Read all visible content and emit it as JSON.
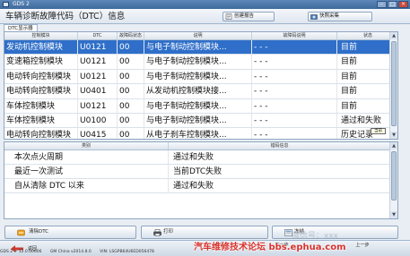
{
  "window": {
    "title": "GDS 2"
  },
  "header": {
    "title": "车辆诊断故障代码（DTC）信息",
    "report_button": "创建报告",
    "save_button": "快照采集"
  },
  "tab": {
    "label": "DTC显示器"
  },
  "dtc_table": {
    "columns": [
      "控制模块",
      "DTC",
      "故障码状态",
      "说明",
      "故障码说明",
      "状态"
    ],
    "rows": [
      [
        "发动机控制模块",
        "U0121",
        "00",
        "与电子制动控制模块...",
        "- - -",
        "目前"
      ],
      [
        "变速箱控制模块",
        "U0121",
        "00",
        "与电子制动控制模块...",
        "- - -",
        "目前"
      ],
      [
        "电动转向控制模块",
        "U0121",
        "00",
        "与电子制动控制模块...",
        "- - -",
        "目前"
      ],
      [
        "电动转向控制模块",
        "U0401",
        "00",
        "从发动机控制模块接...",
        "- - -",
        "目前"
      ],
      [
        "车体控制模块",
        "U0121",
        "00",
        "与电子制动控制模块...",
        "- - -",
        "目前"
      ],
      [
        "车体控制模块",
        "U0100",
        "00",
        "与电子制动控制模块...",
        "- - -",
        "通过和失败"
      ],
      [
        "电动转向控制模块",
        "U0415",
        "00",
        "从电子刹车控制模块...",
        "- - -",
        "历史记录"
      ]
    ],
    "selected_row": 0,
    "tooltip": "当前"
  },
  "detail_table": {
    "columns": [
      "类别",
      "错码信息"
    ],
    "rows": [
      [
        "本次点火周期",
        "通过和失败"
      ],
      [
        "最近一次测试",
        "当前DTC失败"
      ],
      [
        "自从清除 DTC 以来",
        "通过和失败"
      ]
    ]
  },
  "actions": {
    "clear": "清除DTC",
    "print": "打印",
    "freeze": "冻结"
  },
  "nav": {
    "back": "返回",
    "home": "主页",
    "next": "下一步",
    "prev": "上一步"
  },
  "status": {
    "version": "GDS 2 + 12.0.00606",
    "gm": "GM China v2014.8.0",
    "vin": "VIN: LSGPB64U6ED056478"
  },
  "watermark": {
    "main": "汽车维修技术论坛 bbs.ephua.com",
    "ghost": "微信号：xxx"
  },
  "colors": {
    "selection": "#2f6fc9",
    "titlebar": "#4a76a8",
    "watermark": "#d8322c"
  }
}
